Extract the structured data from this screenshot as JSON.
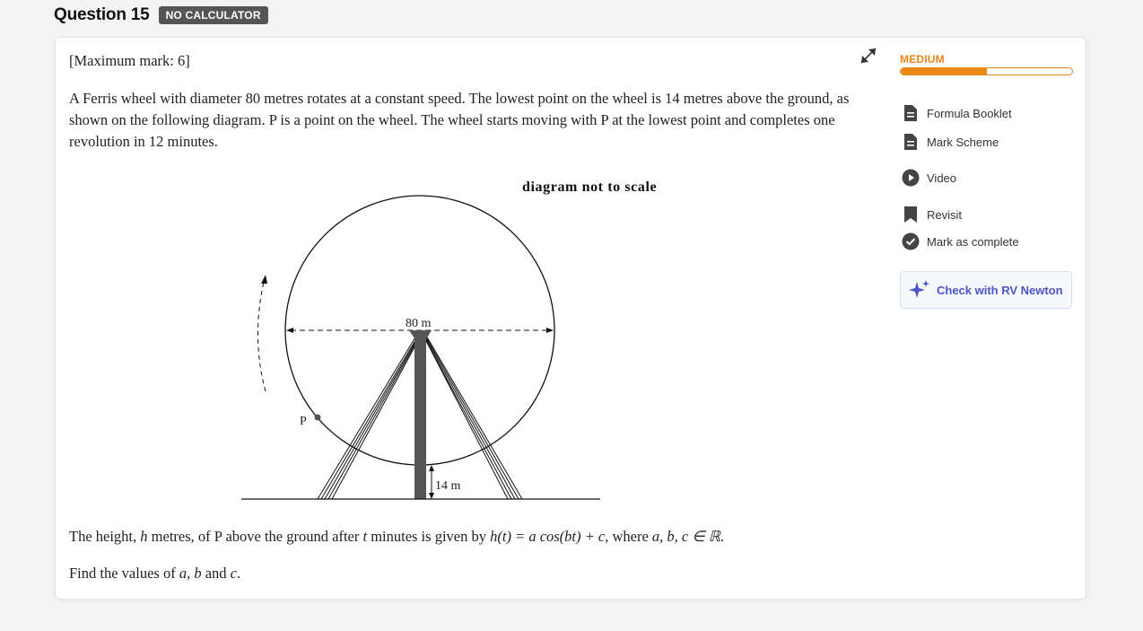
{
  "header": {
    "title": "Question 15",
    "badge": "NO CALCULATOR"
  },
  "question": {
    "max_mark": "[Maximum mark: 6]",
    "intro": "A Ferris wheel with diameter 80 metres rotates at a constant speed. The lowest point on the wheel is 14 metres above the ground, as shown on the following diagram. P is a point on the wheel. The wheel starts moving with P at the lowest point and completes one revolution in 12 minutes.",
    "height_text_a": "The height, ",
    "height_text_h": "h",
    "height_text_b": " metres, of P above the ground after ",
    "height_text_t": "t",
    "height_text_c": " minutes is given by ",
    "formula": "h(t) = a cos(bt) + c",
    "height_text_d": ", where ",
    "params": "a, b, c ∈ ℝ",
    "height_text_e": ".",
    "find_a": "Find the values of ",
    "find_vars": "a, b",
    "find_and": " and ",
    "find_c": "c",
    "find_end": "."
  },
  "diagram": {
    "caption": "diagram not to scale",
    "diameter_label": "80 m",
    "height_label": "14 m",
    "point_label": "P"
  },
  "sidebar": {
    "difficulty": "MEDIUM",
    "difficulty_progress": 0.5,
    "items": [
      {
        "label": "Formula Booklet",
        "icon": "document-icon"
      },
      {
        "label": "Mark Scheme",
        "icon": "document-icon"
      },
      {
        "label": "Video",
        "icon": "play-icon"
      },
      {
        "label": "Revisit",
        "icon": "bookmark-icon"
      },
      {
        "label": "Mark as complete",
        "icon": "check-circle-icon"
      }
    ],
    "check_button": "Check with RV Newton"
  },
  "colors": {
    "accent_orange": "#e8891a",
    "accent_purple": "#4b54c9"
  }
}
